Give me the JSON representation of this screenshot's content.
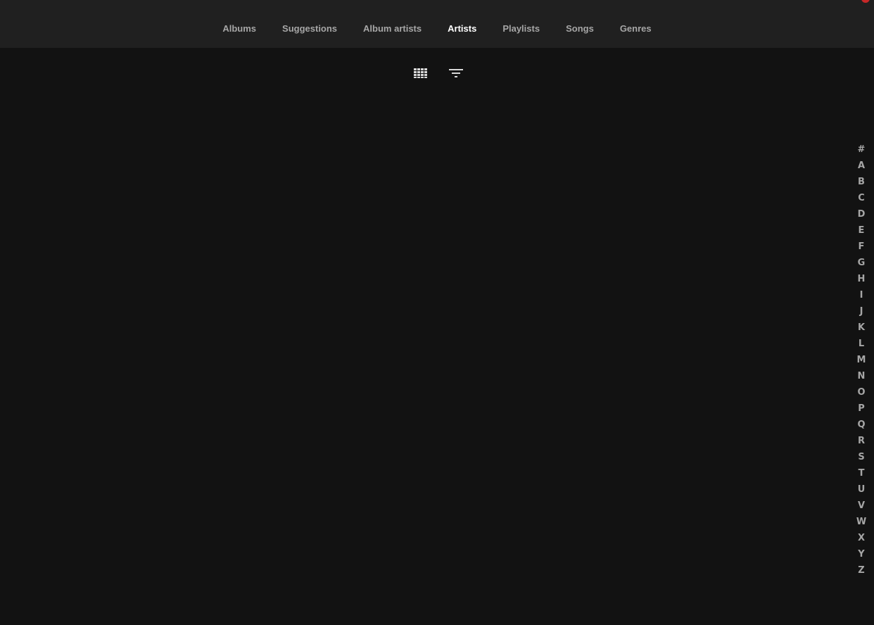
{
  "header": {
    "tabs": [
      {
        "label": "Albums",
        "active": false
      },
      {
        "label": "Suggestions",
        "active": false
      },
      {
        "label": "Album artists",
        "active": false
      },
      {
        "label": "Artists",
        "active": true
      },
      {
        "label": "Playlists",
        "active": false
      },
      {
        "label": "Songs",
        "active": false
      },
      {
        "label": "Genres",
        "active": false
      }
    ]
  },
  "toolbar": {
    "view_icon": "grid-view-icon",
    "filter_icon": "filter-icon"
  },
  "alpha_picker": {
    "letters": [
      "#",
      "A",
      "B",
      "C",
      "D",
      "E",
      "F",
      "G",
      "H",
      "I",
      "J",
      "K",
      "L",
      "M",
      "N",
      "O",
      "P",
      "Q",
      "R",
      "S",
      "T",
      "U",
      "V",
      "W",
      "X",
      "Y",
      "Z"
    ]
  },
  "colors": {
    "background": "#121212",
    "header_bg": "#202020",
    "text_inactive": "#a6a6a6",
    "text_active": "#ffffff",
    "accent": "#c62828"
  }
}
